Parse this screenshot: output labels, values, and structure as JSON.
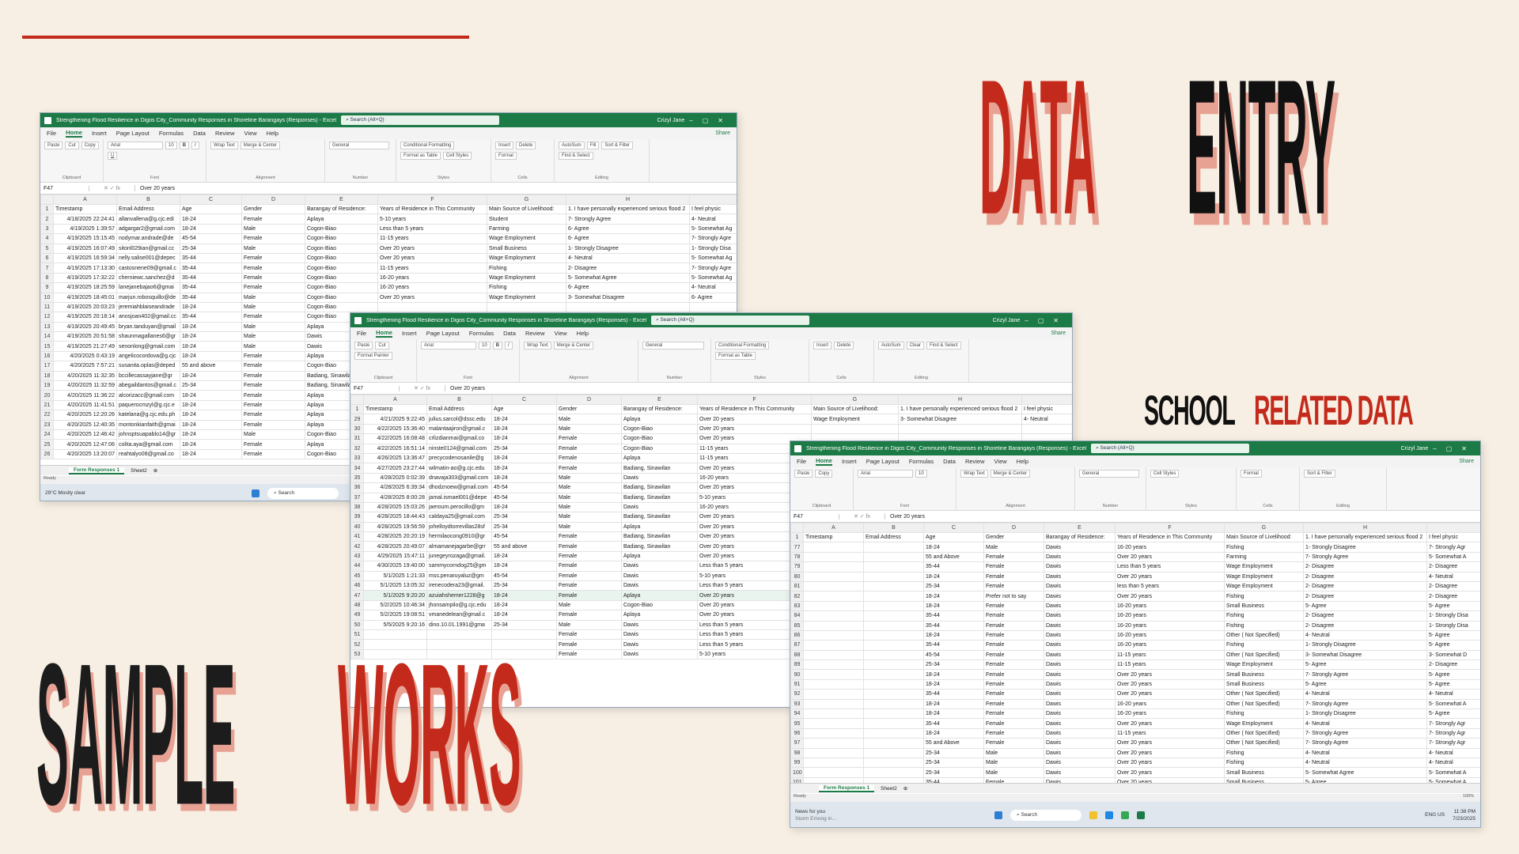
{
  "titles": {
    "data": "DATA",
    "entry": "ENTRY",
    "school": "SCHOOL",
    "related_data": "RELATED DATA",
    "sample": "SAMPLE",
    "works": "WORKS"
  },
  "colors": {
    "accent": "#c42a1b",
    "shadow": "#e8a294",
    "excel_green": "#1b7a45",
    "background": "#f7efe3"
  },
  "excel": {
    "title": "Strengthening Flood Resilience in Digos City_Community Responses in Shoreline Barangays (Responses)  -  Excel",
    "search_placeholder": "Search (Alt+Q)",
    "user": "Crizyl Jane",
    "menu": [
      "File",
      "Home",
      "Insert",
      "Page Layout",
      "Formulas",
      "Data",
      "Review",
      "View",
      "Help"
    ],
    "share": "Share",
    "ribbon": {
      "clipboard": [
        "Paste",
        "Cut",
        "Copy",
        "Format Painter"
      ],
      "font_name": "Arial",
      "font_size": "10",
      "wrap": "Wrap Text",
      "merge": "Merge & Center",
      "number_format": "General",
      "styles": [
        "Conditional Formatting",
        "Format as Table",
        "Cell Styles"
      ],
      "cells": [
        "Insert",
        "Delete",
        "Format"
      ],
      "editing": [
        "AutoSum",
        "Fill",
        "Clear",
        "Sort & Filter",
        "Find & Select"
      ],
      "groups": [
        "Clipboard",
        "Font",
        "Alignment",
        "Number",
        "Styles",
        "Cells",
        "Editing"
      ]
    },
    "fx_value": "Over 20 years",
    "cols": [
      "A",
      "B",
      "C",
      "D",
      "E",
      "F",
      "G",
      "H",
      ""
    ],
    "header": [
      "Timestamp",
      "Email Address",
      "Age",
      "Gender",
      "Barangay of Residence:",
      "Years of Residence in This Community",
      "Main Source of Livelihood:",
      "1. I have personally experienced serious flood 2",
      "I feel physic"
    ],
    "tabs": [
      "Form Responses 1",
      "Sheet2"
    ],
    "status": "Ready",
    "taskbar_search": "Search"
  },
  "win1": {
    "cellref": "F47",
    "rows": [
      [
        "2",
        "4/18/2025 22:24:41",
        "allanvallena@g.cjc.edi",
        "18-24",
        "Female",
        "Aplaya",
        "5-10 years",
        "Student",
        "7- Strongly Agree",
        "4- Neutral"
      ],
      [
        "3",
        "4/19/2025 1:39:57",
        "adgargar2@gmail.com",
        "18-24",
        "Male",
        "Cogon-Biao",
        "Less than 5 years",
        "Farming",
        "6- Agree",
        "5- Somewhat Ag"
      ],
      [
        "4",
        "4/19/2025 15:15:45",
        "nodymar.andrade@de",
        "45-54",
        "Female",
        "Cogon-Biao",
        "11-15 years",
        "Wage Employment",
        "6- Agree",
        "7- Strongly Agre"
      ],
      [
        "5",
        "4/19/2025 16:07:49",
        "sitonl029ian@gmail.cc",
        "25-34",
        "Male",
        "Cogon-Biao",
        "Over 20 years",
        "Small Business",
        "1- Strongly Disagree",
        "1- Strongly Disa"
      ],
      [
        "6",
        "4/19/2025 16:59:34",
        "nelly.salise001@depec",
        "35-44",
        "Female",
        "Cogon-Biao",
        "Over 20 years",
        "Wage Employment",
        "4- Neutral",
        "5- Somewhat Ag"
      ],
      [
        "7",
        "4/19/2025 17:13:30",
        "castosnene09@gmail.c",
        "35-44",
        "Female",
        "Cogon-Biao",
        "11-15 years",
        "Fishing",
        "2- Disagree",
        "7- Strongly Agre"
      ],
      [
        "8",
        "4/19/2025 17:32:22",
        "cherniewc.sanchez@d",
        "35-44",
        "Female",
        "Cogon-Biao",
        "16-20 years",
        "Wage Employment",
        "5- Somewhat Agree",
        "5- Somewhat Ag"
      ],
      [
        "9",
        "4/19/2025 18:25:59",
        "lanejanebajao6@gmai",
        "35-44",
        "Female",
        "Cogon-Biao",
        "16-20 years",
        "Fishing",
        "6- Agree",
        "4- Neutral"
      ],
      [
        "10",
        "4/19/2025 18:45:01",
        "marjun.robosquillo@de",
        "35-44",
        "Male",
        "Cogon-Biao",
        "Over 20 years",
        "Wage Employment",
        "3- Somewhat Disagree",
        "6- Agree"
      ],
      [
        "11",
        "4/19/2025 20:03:23",
        "jeremiahblaiseandrade",
        "18-24",
        "Male",
        "Cogon-Biao",
        "",
        "",
        "",
        ""
      ],
      [
        "12",
        "4/19/2025 20:18:14",
        "anosjoan402@gmail.cc",
        "35-44",
        "Female",
        "Cogon-Biao",
        "",
        "",
        "",
        ""
      ],
      [
        "13",
        "4/19/2025 20:49:45",
        "bryan.tanduyan@gmail",
        "18-24",
        "Male",
        "Aplaya",
        "",
        "",
        "",
        ""
      ],
      [
        "14",
        "4/19/2025 20:51:58",
        "shaunmagallanes6@gr",
        "18-24",
        "Male",
        "Dawis",
        "",
        "",
        "",
        ""
      ],
      [
        "15",
        "4/19/2025 21:27:49",
        "senonlong@gmail.com",
        "18-24",
        "Male",
        "Dawis",
        "",
        "",
        "",
        ""
      ],
      [
        "16",
        "4/20/2025 0:43:19",
        "angelicocordova@g.cjc",
        "18-24",
        "Female",
        "Aplaya",
        "",
        "",
        "",
        ""
      ],
      [
        "17",
        "4/20/2025 7:57:21",
        "susanita.oplas@deped",
        "55 and above",
        "Female",
        "Cogon-Biao",
        "",
        "",
        "",
        ""
      ],
      [
        "18",
        "4/20/2025 11:32:35",
        "bccillecassayjane@gr",
        "18-24",
        "Female",
        "Badiang, Sinawilan",
        "",
        "",
        "",
        ""
      ],
      [
        "19",
        "4/20/2025 11:32:59",
        "abegaildantos@gmail.c",
        "25-34",
        "Female",
        "Badiang, Sinawilan",
        "",
        "",
        "",
        ""
      ],
      [
        "20",
        "4/20/2025 11:36:22",
        "alcorizacc@gmail.com",
        "18-24",
        "Female",
        "Aplaya",
        "",
        "",
        "",
        ""
      ],
      [
        "21",
        "4/20/2025 11:41:51",
        "paquerocmzyl@g.cjc.e",
        "18-24",
        "Female",
        "Aplaya",
        "",
        "",
        "",
        ""
      ],
      [
        "22",
        "4/20/2025 12:20:26",
        "katelana@g.cjc.edu.ph",
        "18-24",
        "Female",
        "Aplaya",
        "",
        "",
        "",
        ""
      ],
      [
        "23",
        "4/20/2025 12:40:35",
        "montonkianfaith@gmai",
        "18-24",
        "Female",
        "Aplaya",
        "",
        "",
        "",
        ""
      ],
      [
        "24",
        "4/20/2025 12:46:42",
        "johnsptsuapablo14@gr",
        "18-24",
        "Male",
        "Cogon-Biao",
        "",
        "",
        "",
        ""
      ],
      [
        "25",
        "4/20/2025 12:47:06",
        "colita.aya@gmail.com",
        "18-24",
        "Female",
        "Aplaya",
        "",
        "",
        "",
        ""
      ],
      [
        "26",
        "4/20/2025 13:20:07",
        "reahtalyo08@gmail.co",
        "18-24",
        "Female",
        "Cogon-Biao",
        "",
        "",
        "",
        ""
      ]
    ],
    "weather_temp": "29°C",
    "weather_desc": "Mostly clear"
  },
  "win2": {
    "cellref": "F47",
    "rows": [
      [
        "29",
        "4/21/2025 9:22:45",
        "julius.sarcol@dssc.edu",
        "18-24",
        "Male",
        "Aplaya",
        "Over 20 years",
        "Wage Employment",
        "3- Somewhat Disagree",
        "4- Neutral"
      ],
      [
        "30",
        "4/22/2025 15:36:40",
        "malantaajiron@gmail.c",
        "18-24",
        "Male",
        "Cogon-Biao",
        "Over 20 years",
        "",
        "",
        " "
      ],
      [
        "31",
        "4/22/2025 16:08:48",
        "crlizdianmai@gmail.co",
        "18-24",
        "Female",
        "Cogon-Biao",
        "Over 20 years",
        "",
        "",
        ""
      ],
      [
        "32",
        "4/22/2025 16:51:14",
        "ninste0124@gmail.com",
        "25-34",
        "Female",
        "Cogon-Biao",
        "11-15 years",
        "",
        "",
        ""
      ],
      [
        "33",
        "4/26/2025 13:36:47",
        "precycodenosanile@g",
        "18-24",
        "Female",
        "Aplaya",
        "11-15 years",
        "",
        "",
        ""
      ],
      [
        "34",
        "4/27/2025 23:27:44",
        "wilmatin-ao@g.cjc.edu",
        "18-24",
        "Female",
        "Badiang, Sinawilan",
        "Over 20 years",
        "",
        "",
        ""
      ],
      [
        "35",
        "4/28/2025 0:02:39",
        "dnavaja303@gmail.com",
        "18-24",
        "Male",
        "Dawis",
        "16-20 years",
        "",
        "",
        ""
      ],
      [
        "36",
        "4/28/2025 6:39:34",
        "dhodznoew@gmail.com",
        "45-54",
        "Male",
        "Badiang, Sinawilan",
        "Over 20 years",
        "",
        "",
        ""
      ],
      [
        "37",
        "4/28/2025 8:00:28",
        "jamal.ismael001@depe",
        "45-54",
        "Male",
        "Badiang, Sinawilan",
        "5-10 years",
        "",
        "",
        ""
      ],
      [
        "38",
        "4/28/2025 15:03:26",
        "jaeroum.perocillo@gm",
        "18-24",
        "Male",
        "Dawis",
        "16-20 years",
        "",
        "",
        ""
      ],
      [
        "39",
        "4/28/2025 18:44:43",
        "caldaya25@gmail.com",
        "25-34",
        "Male",
        "Badiang, Sinawilan",
        "Over 20 years",
        "",
        "",
        ""
      ],
      [
        "40",
        "4/28/2025 19:56:59",
        "johelloydtorrevillas28sf",
        "25-34",
        "Male",
        "Aplaya",
        "Over 20 years",
        "",
        "",
        ""
      ],
      [
        "41",
        "4/28/2025 20:20:19",
        "hermilaocong0910@gr",
        "45-54",
        "Female",
        "Badiang, Sinawilan",
        "Over 20 years",
        "",
        "",
        ""
      ],
      [
        "42",
        "4/28/2025 20:49:07",
        "almamanejagarbe@grr",
        "55 and above",
        "Female",
        "Badiang, Sinawilan",
        "Over 20 years",
        "",
        "",
        ""
      ],
      [
        "43",
        "4/29/2025 15:47:11",
        "junegeyrozaga@gmail.",
        "18-24",
        "Female",
        "Aplaya",
        "Over 20 years",
        "",
        "",
        ""
      ],
      [
        "44",
        "4/30/2025 19:40:00",
        "sammycorndog25@gm",
        "18-24",
        "Female",
        "Dawis",
        "Less than 5 years",
        "",
        "",
        ""
      ],
      [
        "45",
        "5/1/2025 1:21:33",
        "mss.penaruyaluz@gm",
        "45-54",
        "Female",
        "Dawis",
        "5-10 years",
        "",
        "",
        ""
      ],
      [
        "46",
        "5/1/2025 13:05:32",
        "irenecodera23@gmail.",
        "25-34",
        "Female",
        "Dawis",
        "Less than 5 years",
        "",
        "",
        ""
      ],
      [
        "47",
        "5/1/2025 9:20:20",
        "azuiahshemer1228@g",
        "18-24",
        "Female",
        "Aplaya",
        "Over 20 years",
        "",
        "",
        ""
      ],
      [
        "48",
        "5/2/2025 10:46:34",
        "jhonsampilo@g.cjc.edu",
        "18-24",
        "Male",
        "Cogon-Biao",
        "Over 20 years",
        "",
        "",
        ""
      ],
      [
        "49",
        "5/2/2025 19:08:51",
        "vmanedelean@gmail.c",
        "18-24",
        "Female",
        "Aplaya",
        "Over 20 years",
        "",
        "",
        ""
      ],
      [
        "50",
        "5/5/2025 9:20:16",
        "dino.10.01.1991@gma",
        "25-34",
        "Male",
        "Dawis",
        "Less than 5 years",
        "",
        "",
        ""
      ],
      [
        "51",
        "",
        "",
        "",
        "Female",
        "Dawis",
        "Less than 5 years",
        "",
        "",
        ""
      ],
      [
        "52",
        "",
        "",
        "",
        "Female",
        "Dawis",
        "Less than 5 years",
        "",
        "",
        ""
      ],
      [
        "53",
        "",
        "",
        "",
        "Female",
        "Dawis",
        "5-10 years",
        "",
        "",
        ""
      ]
    ]
  },
  "win3": {
    "cellref": "F47",
    "time": "11:38 PM",
    "date": "7/23/2025",
    "news": "News for you",
    "news_sub": "Storm Emong in...",
    "lang": "ENG US",
    "zoom": "100%",
    "rows": [
      [
        "77",
        "",
        "",
        "18-24",
        "Male",
        "Dawis",
        "16-20 years",
        "Fishing",
        "1- Strongly Disagree",
        "7- Strongly Agr"
      ],
      [
        "78",
        "",
        "",
        "55 and Above",
        "Female",
        "Dawis",
        "Over 20 years",
        "Farming",
        "7- Strongly Agree",
        "5- Somewhat A"
      ],
      [
        "79",
        "",
        "",
        "35-44",
        "Female",
        "Dawis",
        "Less than 5 years",
        "Wage Employment",
        "2- Disagree",
        "2- Disagree"
      ],
      [
        "80",
        "",
        "",
        "18-24",
        "Female",
        "Dawis",
        "Over 20 years",
        "Wage Employment",
        "2- Disagree",
        "4- Neutral"
      ],
      [
        "81",
        "",
        "",
        "25-34",
        "Female",
        "Dawis",
        "less than 5 years",
        "Wage Employment",
        "2- Disagree",
        "2- Disagree"
      ],
      [
        "82",
        "",
        "",
        "18-24",
        "Prefer not to say",
        "Dawis",
        "Over 20 years",
        "Fishing",
        "2- Disagree",
        "2- Disagree"
      ],
      [
        "83",
        "",
        "",
        "18-24",
        "Female",
        "Dawis",
        "16-20 years",
        "Small Business",
        "5- Agree",
        "5- Agree"
      ],
      [
        "84",
        "",
        "",
        "35-44",
        "Female",
        "Dawis",
        "16-20 years",
        "Fishing",
        "2- Disagree",
        "1- Strongly Disa"
      ],
      [
        "85",
        "",
        "",
        "35-44",
        "Female",
        "Dawis",
        "16-20 years",
        "Fishing",
        "2- Disagree",
        "1- Strongly Disa"
      ],
      [
        "86",
        "",
        "",
        "18-24",
        "Female",
        "Dawis",
        "16-20 years",
        "Other ( Not Specified)",
        "4- Neutral",
        "5- Agree"
      ],
      [
        "87",
        "",
        "",
        "35-44",
        "Female",
        "Dawis",
        "16-20 years",
        "Fishing",
        "1- Strongly Disagree",
        "5- Agree"
      ],
      [
        "88",
        "",
        "",
        "45-54",
        "Female",
        "Dawis",
        "11-15 years",
        "Other ( Not Specified)",
        "3- Somewhat Disagree",
        "3- Somewhat D"
      ],
      [
        "89",
        "",
        "",
        "25-34",
        "Female",
        "Dawis",
        "11-15 years",
        "Wage Employment",
        "5- Agree",
        "2- Disagree"
      ],
      [
        "90",
        "",
        "",
        "18-24",
        "Female",
        "Dawis",
        "Over 20 years",
        "Small Business",
        "7- Strongly Agree",
        "5- Agree"
      ],
      [
        "91",
        "",
        "",
        "18-24",
        "Female",
        "Dawis",
        "Over 20 years",
        "Small Business",
        "5- Agree",
        "5- Agree"
      ],
      [
        "92",
        "",
        "",
        "35-44",
        "Female",
        "Dawis",
        "Over 20 years",
        "Other ( Not Specified)",
        "4- Neutral",
        "4- Neutral"
      ],
      [
        "93",
        "",
        "",
        "18-24",
        "Female",
        "Dawis",
        "16-20 years",
        "Other ( Not Specified)",
        "7- Strongly Agree",
        "5- Somewhat A"
      ],
      [
        "94",
        "",
        "",
        "18-24",
        "Female",
        "Dawis",
        "16-20 years",
        "Fishing",
        "1- Strongly Disagree",
        "5- Agree"
      ],
      [
        "95",
        "",
        "",
        "35-44",
        "Female",
        "Dawis",
        "Over 20 years",
        "Wage Employment",
        "4- Neutral",
        "7- Strongly Agr"
      ],
      [
        "96",
        "",
        "",
        "18-24",
        "Female",
        "Dawis",
        "11-15 years",
        "Other ( Not Specified)",
        "7- Strongly Agree",
        "7- Strongly Agr"
      ],
      [
        "97",
        "",
        "",
        "55 and Above",
        "Female",
        "Dawis",
        "Over 20 years",
        "Other ( Not Specified)",
        "7- Strongly Agree",
        "7- Strongly Agr"
      ],
      [
        "98",
        "",
        "",
        "25-34",
        "Male",
        "Dawis",
        "Over 20 years",
        "Fishing",
        "4- Neutral",
        "4- Neutral"
      ],
      [
        "99",
        "",
        "",
        "25-34",
        "Male",
        "Dawis",
        "Over 20 years",
        "Fishing",
        "4- Neutral",
        "4- Neutral"
      ],
      [
        "100",
        "",
        "",
        "25-34",
        "Male",
        "Dawis",
        "Over 20 years",
        "Small Business",
        "5- Somewhat Agree",
        "5- Somewhat A"
      ],
      [
        "101",
        "",
        "",
        "35-44",
        "Female",
        "Dawis",
        "Over 20 years",
        "Small Business",
        "5- Agree",
        "5- Somewhat A"
      ]
    ]
  }
}
